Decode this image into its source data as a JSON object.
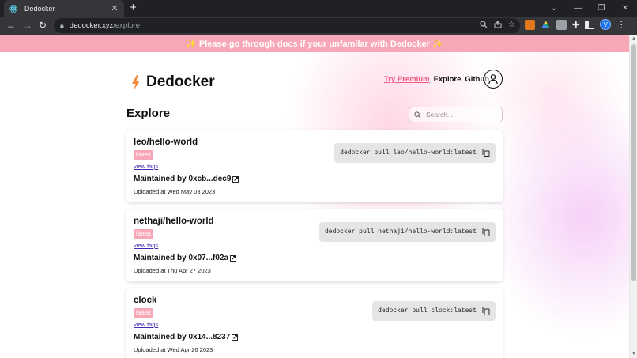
{
  "browser": {
    "tab_title": "Dedocker",
    "tab_close": "✕",
    "new_tab": "+",
    "url_host": "dedocker.xyz",
    "url_path": "/explore",
    "profile_initial": "V"
  },
  "banner": {
    "text": "✨ Please go through docs if your unfamilar with Dedocker ✨"
  },
  "header": {
    "brand": "Dedocker",
    "nav": {
      "premium": "Try Premium",
      "explore": "Explore",
      "github": "Github"
    }
  },
  "explore": {
    "title": "Explore",
    "search_placeholder": "Search..."
  },
  "cards": [
    {
      "repo": "leo/hello-world",
      "tag": "latest",
      "view_tags": "view tags",
      "maintainer": "Maintained by 0xcb...dec9",
      "uploaded": "Uploaded at Wed May 03 2023",
      "command": "dedocker pull leo/hello-world:latest"
    },
    {
      "repo": "nethaji/hello-world",
      "tag": "latest",
      "view_tags": "view tags",
      "maintainer": "Maintained by 0x07...f02a",
      "uploaded": "Uploaded at Thu Apr 27 2023",
      "command": "dedocker pull nethaji/hello-world:latest"
    },
    {
      "repo": "clock",
      "tag": "latest",
      "view_tags": "view tags",
      "maintainer": "Maintained by 0x14...8237",
      "uploaded": "Uploaded at Wed Apr 26 2023",
      "command": "dedocker pull clock:latest"
    }
  ],
  "colors": {
    "accent_pink": "#f8a7b6",
    "premium_link": "#f2587f",
    "bolt": "#f2883a"
  }
}
